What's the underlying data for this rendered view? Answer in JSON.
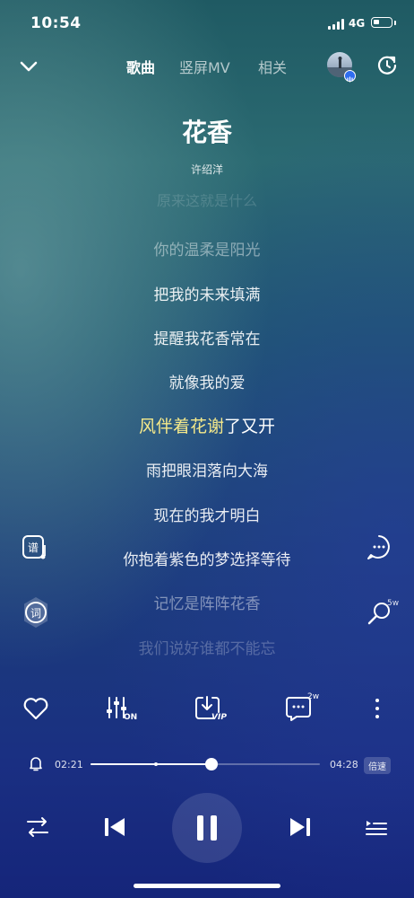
{
  "status_bar": {
    "time": "10:54",
    "network": "4G"
  },
  "nav": {
    "tabs": [
      {
        "label": "歌曲",
        "active": true
      },
      {
        "label": "竖屏MV",
        "active": false
      },
      {
        "label": "相关",
        "active": false
      }
    ]
  },
  "song": {
    "title": "花香",
    "artist": "许绍洋"
  },
  "lyrics": {
    "partial_top": "原来这就是什么",
    "lines": [
      "你的温柔是阳光",
      "把我的未来填满",
      "提醒我花香常在",
      "就像我的爱",
      "雨把眼泪落向大海",
      "现在的我才明白",
      "你抱着紫色的梦选择等待",
      "记忆是阵阵花香",
      "我们说好谁都不能忘"
    ],
    "current": {
      "sung": "风伴着花谢",
      "unsung": "了又开"
    }
  },
  "side": {
    "left_top_label": "谱",
    "left_bottom_label": "词",
    "right_bottom_count": "5w"
  },
  "actions": {
    "eq_badge": "ON",
    "download_badge": "VIP",
    "comment_count": "2w"
  },
  "progress": {
    "current": "02:21",
    "duration": "04:28",
    "fraction": 0.527,
    "buffered": 0.287,
    "speed_label": "倍速"
  },
  "colors": {
    "highlight": "#f5e98a",
    "accent_blue": "#2f6df0"
  },
  "icons": [
    "chevron-down-icon",
    "refresh-icon",
    "heart-icon",
    "equalizer-icon",
    "download-icon",
    "comment-icon",
    "more-icon",
    "bell-icon",
    "shuffle-icon",
    "previous-icon",
    "pause-icon",
    "next-icon",
    "playlist-icon"
  ]
}
